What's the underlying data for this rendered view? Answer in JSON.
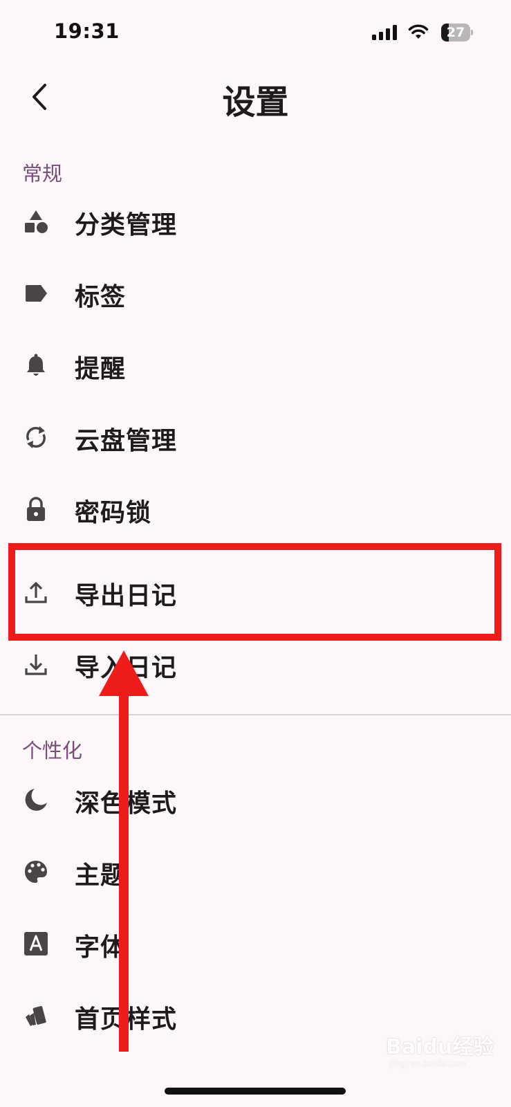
{
  "status_bar": {
    "time": "19:31",
    "battery": "27",
    "battery_level": 0.27
  },
  "header": {
    "title": "设置",
    "back_icon": "chevron-left-icon"
  },
  "sections": [
    {
      "title": "常规",
      "items": [
        {
          "label": "分类管理",
          "icon": "category-shapes-icon"
        },
        {
          "label": "标签",
          "icon": "label-tag-icon"
        },
        {
          "label": "提醒",
          "icon": "bell-icon"
        },
        {
          "label": "云盘管理",
          "icon": "sync-icon"
        },
        {
          "label": "密码锁",
          "icon": "lock-icon"
        },
        {
          "label": "导出日记",
          "icon": "upload-icon"
        },
        {
          "label": "导入日记",
          "icon": "download-icon"
        }
      ]
    },
    {
      "title": "个性化",
      "items": [
        {
          "label": "深色模式",
          "icon": "moon-icon"
        },
        {
          "label": "主题",
          "icon": "palette-icon"
        },
        {
          "label": "字体",
          "icon": "font-icon"
        },
        {
          "label": "首页样式",
          "icon": "cards-style-icon"
        }
      ]
    }
  ],
  "colors": {
    "background": "#fdf7fa",
    "section_title": "#7a4e7a",
    "icon": "#4a4449",
    "annotation": "#ee1b1b"
  },
  "watermark": {
    "logo": "Baidu经验",
    "url": "jingyan.baidu.com"
  }
}
